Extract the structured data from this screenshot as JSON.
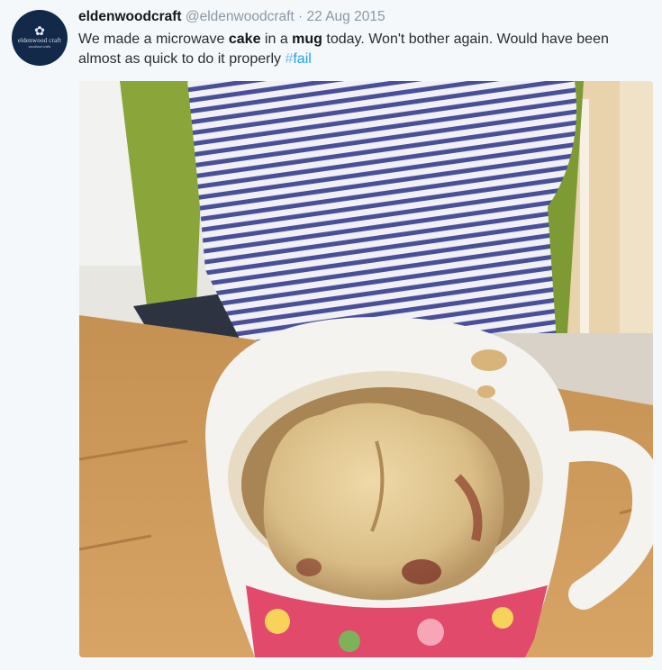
{
  "tweet": {
    "author": {
      "display_name": "eldenwoodcraft",
      "handle": "@eldenwoodcraft",
      "avatar_text": "eldenwood craft",
      "avatar_tagline": "woodland crafts"
    },
    "separator": "·",
    "date": "22 Aug 2015",
    "text_parts": {
      "p1": "We made a microwave ",
      "b1": "cake",
      "p2": " in a ",
      "b2": "mug",
      "p3": " today. Won't bother again. Would have been almost as quick to do it properly "
    },
    "hashtag": {
      "symbol": "#",
      "tag": "fail"
    },
    "media": {
      "icon": "photo-icon",
      "subject": "mug-cake-photo"
    }
  },
  "colors": {
    "link": "#1da1f2",
    "meta": "#8899a6",
    "text": "#292f33",
    "avatar_bg": "#12294a",
    "background": "#f5f8fa"
  }
}
